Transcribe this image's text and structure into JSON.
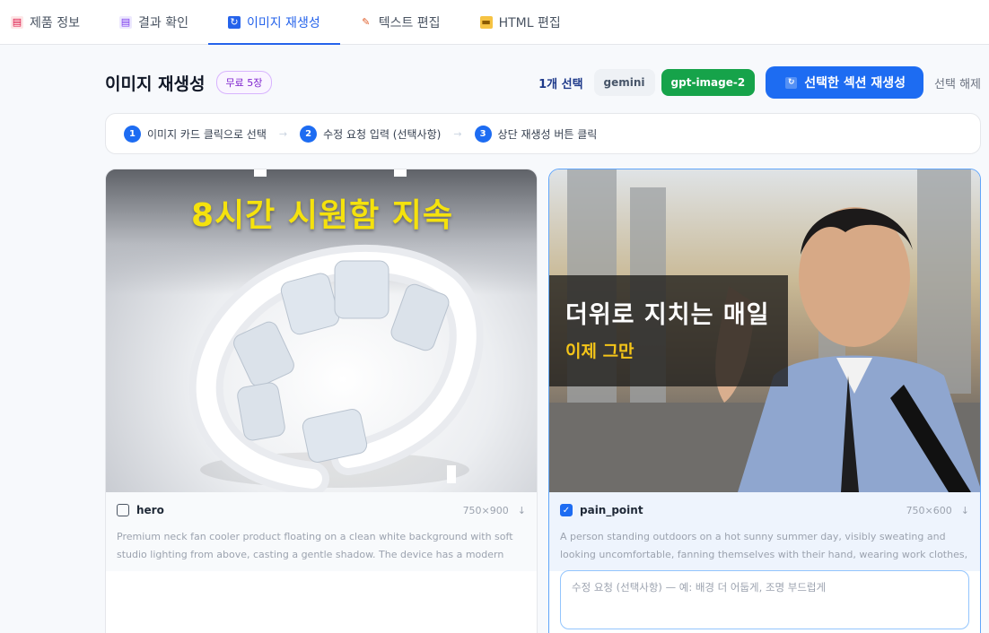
{
  "tabs": [
    {
      "label": "제품 정보",
      "icon": "product-doc-icon",
      "active": false
    },
    {
      "label": "결과 확인",
      "icon": "result-doc-icon",
      "active": false
    },
    {
      "label": "이미지 재생성",
      "icon": "regenerate-icon",
      "active": true
    },
    {
      "label": "텍스트 편집",
      "icon": "pencil-icon",
      "active": false
    },
    {
      "label": "HTML 편집",
      "icon": "folder-icon",
      "active": false
    }
  ],
  "header": {
    "title": "이미지 재생성",
    "free_badge": "무료 5장",
    "selected_count": "1개 선택",
    "model_gemini": "gemini",
    "model_gpt": "gpt-image-2",
    "regen_button": "선택한 섹션 재생성",
    "deselect": "선택 해제"
  },
  "steps": [
    {
      "num": "1",
      "text": "이미지 카드 클릭으로 선택"
    },
    {
      "num": "2",
      "text": "수정 요청 입력 (선택사항)"
    },
    {
      "num": "3",
      "text": "상단 재생성 버튼 클릭"
    }
  ],
  "step_arrow": "→",
  "cards": [
    {
      "name": "hero",
      "checked": false,
      "dims": "750×900",
      "download": "↓",
      "image_headline": "8시간 시원함 지속",
      "prompt": "Premium neck fan cooler product floating on a clean white background with soft studio lighting from above, casting a gentle shadow. The device has a modern U-..."
    },
    {
      "name": "pain_point",
      "checked": true,
      "dims": "750×600",
      "download": "↓",
      "image_headline": "더위로 지치는 매일",
      "image_subline": "이제 그만",
      "prompt": "A person standing outdoors on a hot sunny summer day, visibly sweating and looking uncomfortable, fanning themselves with their hand, wearing work clothes, urban city...",
      "edit_placeholder": "수정 요청 (선택사항) — 예: 배경 더 어둡게, 조명 부드럽게"
    }
  ],
  "colors": {
    "accent": "#1d6cf2",
    "gpt_green": "#16a34a",
    "headline_yellow": "#f5e20d",
    "free_badge_purple": "#7e22ce"
  }
}
